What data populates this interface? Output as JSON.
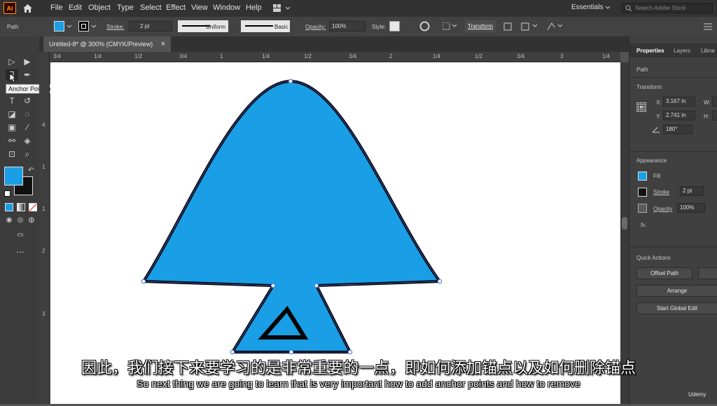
{
  "app": {
    "logo": "Ai",
    "workspace": "Essentials",
    "search_placeholder": "Search Adobe Stock"
  },
  "menu": [
    "File",
    "Edit",
    "Object",
    "Type",
    "Select",
    "Effect",
    "View",
    "Window",
    "Help"
  ],
  "control_bar": {
    "selection_type": "Path",
    "stroke_label": "Stroke:",
    "stroke_weight": "2 pt",
    "profile": "Uniform",
    "brush": "Basic",
    "opacity_label": "Opacity:",
    "opacity": "100%",
    "style_label": "Style:",
    "transform_label": "Transform"
  },
  "document": {
    "tab_title": "Untitled-8* @ 300% (CMYK/Preview)",
    "close": "×"
  },
  "ruler": {
    "top_labels": [
      "3/4",
      "1/4",
      "1/2",
      "3/4",
      "1",
      "1/4",
      "1/2",
      "3/4",
      "2",
      "1/4",
      "1/2",
      "3/4",
      "3",
      "1/4"
    ],
    "left_labels": [
      "4",
      "1",
      "1",
      "2",
      "3"
    ]
  },
  "toolbox": {
    "tooltip": "Anchor Point Tool (Shift+C)"
  },
  "properties": {
    "tabs": [
      "Properties",
      "Layers",
      "Librar"
    ],
    "type": "Path",
    "transform_title": "Transform",
    "x_label": "X:",
    "x": "3.167 in",
    "y_label": "Y:",
    "y": "2.741 in",
    "w_label": "W:",
    "h_label": "H:",
    "angle": "180°",
    "appearance_title": "Appearance",
    "fill_label": "Fill",
    "stroke_label": "Stroke",
    "stroke_weight": "2 pt",
    "opacity_label": "Opacity",
    "opacity": "100%",
    "fx": "fx.",
    "quick_actions_title": "Quick Actions",
    "offset_path": "Offset Path",
    "arrange": "Arrange",
    "start_global_edit": "Start Global Edit"
  },
  "colors": {
    "fill": "#1a9ee6",
    "stroke": "#000000",
    "accent": "#ff9a00"
  },
  "subtitles": {
    "cn": "因此，我们接下来要学习的是非常重要的一点，即如何添加锚点以及如何删除锚点",
    "en": "So next thing we are going to learn that is very important how to add anchor points and how to remove"
  },
  "watermark": "Udemy"
}
